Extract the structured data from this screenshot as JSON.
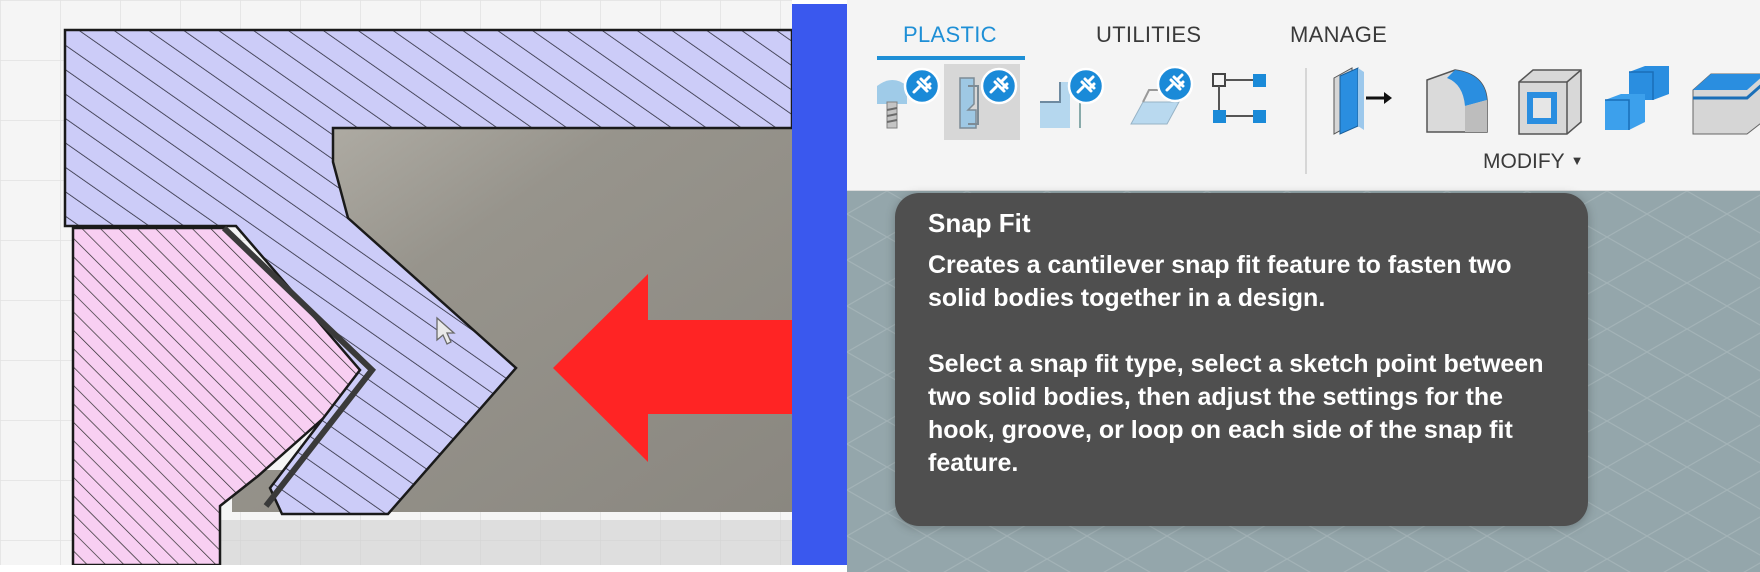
{
  "ribbon": {
    "tabs": [
      {
        "label": "PLASTIC",
        "active": true
      },
      {
        "label": "UTILITIES",
        "active": false
      },
      {
        "label": "MANAGE",
        "active": false
      }
    ],
    "tools": [
      {
        "icon": "boss-plug-icon",
        "selected": false
      },
      {
        "icon": "snap-fit-icon",
        "selected": true
      },
      {
        "icon": "lip-groove-icon",
        "selected": false
      },
      {
        "icon": "rib-web-icon",
        "selected": false
      },
      {
        "icon": "sketch-points-icon",
        "selected": false
      },
      {
        "icon": "press-pull-icon",
        "selected": false
      },
      {
        "icon": "fillet-icon",
        "selected": false
      },
      {
        "icon": "shell-icon",
        "selected": false
      },
      {
        "icon": "combine-icon",
        "selected": false
      },
      {
        "icon": "offset-face-icon",
        "selected": false
      }
    ],
    "modify_label": "MODIFY"
  },
  "tooltip": {
    "title": "Snap Fit",
    "description": "Creates a cantilever snap fit feature to fasten two solid bodies together in a design.",
    "instructions": "Select a snap fit type, select a sketch point between two solid bodies, then adjust the settings for the hook, groove, or loop on each side of the snap fit feature."
  },
  "colors": {
    "accent": "#1e8fd6",
    "arrow": "#ff2424",
    "divider": "#3a58ee",
    "body_a_hatch": "#ccccf8",
    "body_b_hatch": "#f8cff2",
    "tooltip_bg": "#4f4f4f"
  }
}
